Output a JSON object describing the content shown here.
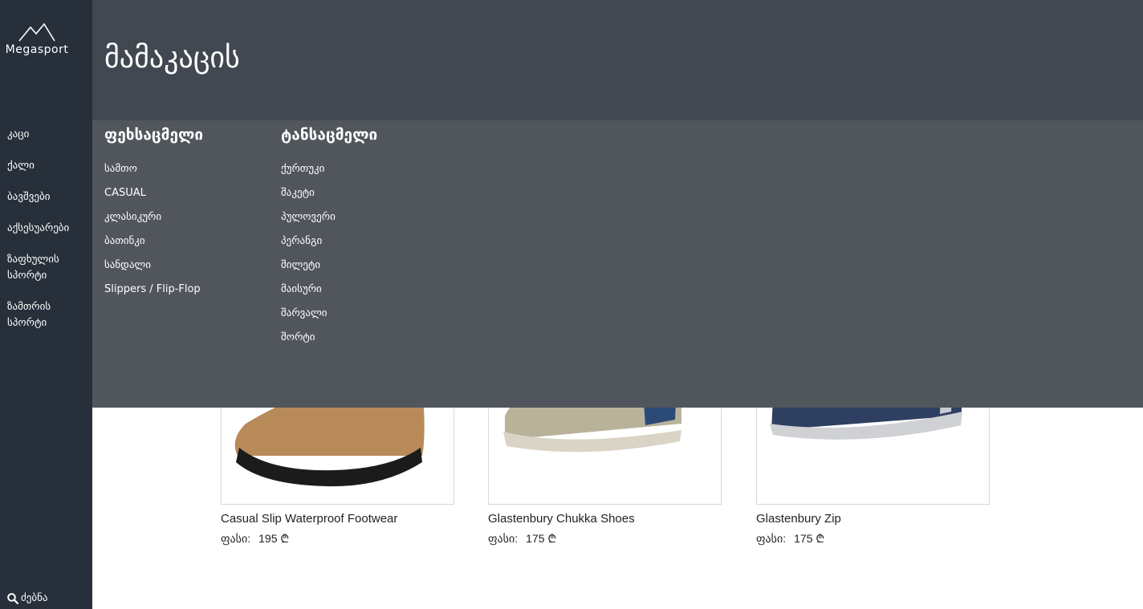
{
  "brand": {
    "name": "Megasport",
    "logo_icon": "mountain-icon"
  },
  "sidebar": {
    "items": [
      {
        "label": "კაცი"
      },
      {
        "label": "ქალი"
      },
      {
        "label": "ბავშვები"
      },
      {
        "label": "აქსესუარები"
      },
      {
        "label": "ზაფხულის სპორტი"
      },
      {
        "label": "ზამთრის სპორტი"
      }
    ],
    "search": {
      "label": "ძებნა",
      "icon": "search-icon"
    }
  },
  "header": {
    "title": "მამაკაცის"
  },
  "mega_menu": {
    "columns": [
      {
        "heading": "ფეხსაცმელი",
        "items": [
          "სამთო",
          "CASUAL",
          "კლასიკური",
          "ბათინკი",
          "სანდალი",
          "Slippers / Flip-Flop"
        ]
      },
      {
        "heading": "ტანსაცმელი",
        "items": [
          "ქურთუკი",
          "შაკეტი",
          "პულოვერი",
          "პერანგი",
          "შილეტი",
          "მაისური",
          "შარვალი",
          "შორტი"
        ]
      }
    ]
  },
  "products": [
    {
      "name": "Casual Slip Waterproof Footwear",
      "price_label": "ფასი:",
      "price": "195 ₾"
    },
    {
      "name": "Glastenbury Chukka Shoes",
      "price_label": "ფასი:",
      "price": "175 ₾"
    },
    {
      "name": "Glastenbury Zip",
      "price_label": "ფასი:",
      "price": "175 ₾"
    }
  ],
  "colors": {
    "sidebar_bg": "#262f3a",
    "header_bg": "#414851",
    "mega_menu_bg": "#51565d"
  }
}
